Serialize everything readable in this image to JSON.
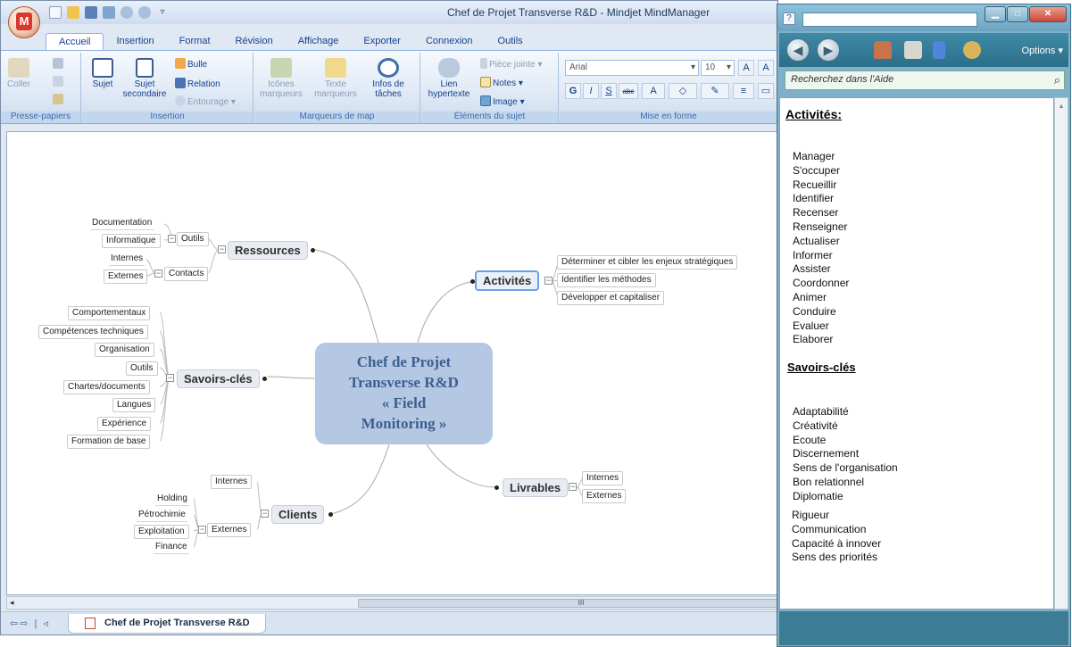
{
  "window": {
    "title": "Chef de Projet Transverse R&D   - Mindjet MindManager"
  },
  "app_button_letter": "M",
  "tabs": [
    "Accueil",
    "Insertion",
    "Format",
    "Révision",
    "Affichage",
    "Exporter",
    "Connexion",
    "Outils"
  ],
  "ribbon": {
    "groups": {
      "clipboard": "Presse-papiers",
      "insertion": "Insertion",
      "markers": "Marqueurs de map",
      "elements": "Éléments du sujet",
      "format": "Mise en forme"
    },
    "coller": "Coller",
    "sujet": "Sujet",
    "sujet_secondaire": "Sujet secondaire",
    "bulle": "Bulle",
    "relation": "Relation",
    "entourage": "Entourage",
    "icones": "Icônes marqueurs",
    "texte": "Texte marqueurs",
    "infos": "Infos de tâches",
    "lien": "Lien hypertexte",
    "piece_jointe": "Pièce jointe",
    "notes": "Notes",
    "image": "Image",
    "font_name": "Arial",
    "font_size": "10",
    "grow": "A",
    "bold": "G",
    "italic": "I",
    "underline": "S",
    "strike": "abc"
  },
  "map": {
    "central": [
      "Chef de Projet",
      "Transverse R&D",
      "« Field",
      "Monitoring »"
    ],
    "ressources": {
      "label": "Ressources",
      "outils": "Outils",
      "outils_children": [
        "Documentation",
        "Informatique"
      ],
      "contacts": "Contacts",
      "contacts_children": [
        "Internes",
        "Externes"
      ]
    },
    "savoirs": {
      "label": "Savoirs-clés",
      "children": [
        "Comportementaux",
        "Compétences techniques",
        "Organisation",
        "Outils",
        "Chartes/documents",
        "Langues",
        "Expérience",
        "Formation de base"
      ]
    },
    "clients": {
      "label": "Clients",
      "internes": "Internes",
      "externes": "Externes",
      "externes_children": [
        "Holding",
        "Pétrochimie",
        "Exploitation",
        "Finance"
      ]
    },
    "activites": {
      "label": "Activités",
      "children": [
        "Déterminer et cibler les enjeux stratégiques",
        "Identifier les méthodes",
        "Développer et capitaliser"
      ]
    },
    "livrables": {
      "label": "Livrables",
      "children": [
        "Internes",
        "Externes"
      ]
    }
  },
  "scrollbar_grip": "III",
  "document_tab": "Chef de Projet Transverse R&D",
  "help": {
    "question_mark": "?",
    "options": "Options",
    "search_placeholder": "Recherchez dans l'Aide",
    "section1_title": "Activités:",
    "activities": [
      "Manager",
      "S'occuper",
      "Recueillir",
      "Identifier",
      "Recenser",
      "Renseigner",
      "Actualiser",
      "Informer",
      "Assister",
      "Coordonner",
      "Animer",
      "Conduire",
      "Evaluer",
      "Elaborer"
    ],
    "section2_title": "Savoirs-clés",
    "skills_a": [
      "Adaptabilité",
      "Créativité",
      "Ecoute",
      "Discernement",
      "Sens de l'organisation",
      "Bon relationnel",
      "Diplomatie"
    ],
    "skills_b": [
      "Rigueur",
      "Communication",
      "Capacité à innover",
      "Sens des priorités"
    ]
  }
}
